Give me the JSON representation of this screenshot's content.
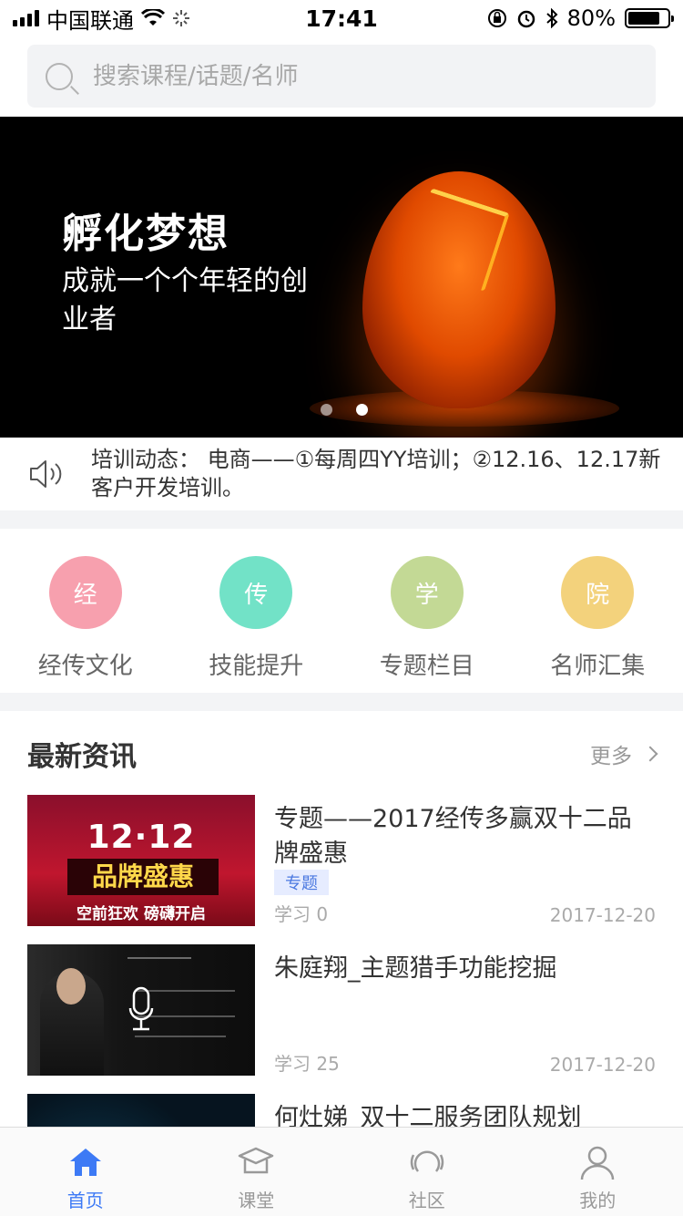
{
  "status_bar": {
    "carrier": "中国联通",
    "time": "17:41",
    "battery": "80%",
    "battery_level": 0.8
  },
  "search": {
    "placeholder": "搜索课程/话题/名师"
  },
  "banner": {
    "title": "孵化梦想",
    "subtitle": "成就一个个年轻的创业者",
    "slide_count": 2,
    "active_slide": 2
  },
  "notice": {
    "text": "培训动态： 电商——①每周四YY培训；②12.16、12.17新客户开发培训。"
  },
  "categories": [
    {
      "char": "经",
      "label": "经传文化",
      "color": "#f7a0ae"
    },
    {
      "char": "传",
      "label": "技能提升",
      "color": "#72e2c7"
    },
    {
      "char": "学",
      "label": "专题栏目",
      "color": "#c3d995"
    },
    {
      "char": "院",
      "label": "名师汇集",
      "color": "#f3d27c"
    }
  ],
  "news": {
    "section_title": "最新资讯",
    "more_label": "更多",
    "items": [
      {
        "title": "专题——2017经传多赢双十二品牌盛惠",
        "tag": "专题",
        "learn": "学习 0",
        "date": "2017-12-20",
        "thumb": {
          "main": "12·12",
          "mid": "品牌盛惠",
          "foot": "空前狂欢 磅礴开启"
        }
      },
      {
        "title": "朱庭翔_主题猎手功能挖掘",
        "learn": "学习 25",
        "date": "2017-12-20"
      },
      {
        "title": "何灶娣_双十二服务团队规划"
      }
    ]
  },
  "tabbar": {
    "items": [
      {
        "label": "首页",
        "icon": "home-icon",
        "active": true
      },
      {
        "label": "课堂",
        "icon": "graduation-cap-icon",
        "active": false
      },
      {
        "label": "社区",
        "icon": "community-icon",
        "active": false
      },
      {
        "label": "我的",
        "icon": "user-icon",
        "active": false
      }
    ],
    "active_color": "#3d7af5",
    "inactive_color": "#999999"
  }
}
